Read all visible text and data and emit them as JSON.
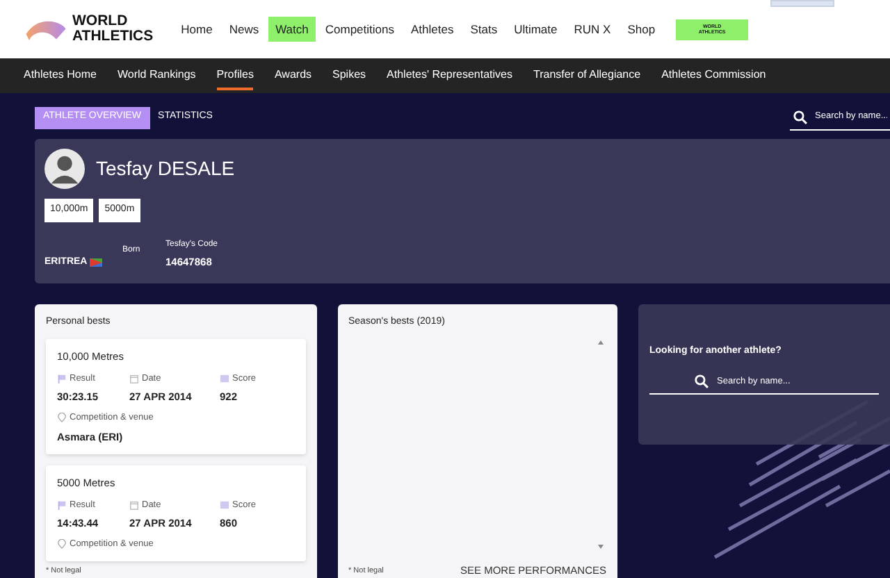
{
  "header": {
    "logo": {
      "line_1": "WORLD",
      "line_2": "ATHLETICS"
    },
    "nav": [
      {
        "label": "Home",
        "selected": false
      },
      {
        "label": "News",
        "selected": false
      },
      {
        "label": "Watch",
        "selected": true
      },
      {
        "label": "Competitions",
        "selected": false
      },
      {
        "label": "Athletes",
        "selected": false
      },
      {
        "label": "Stats",
        "selected": false
      },
      {
        "label": "Ultimate",
        "selected": false
      },
      {
        "label": "RUN X",
        "selected": false
      },
      {
        "label": "Shop",
        "selected": false
      }
    ],
    "promo": {
      "line_1": "WORLD",
      "line_2": "ATHLETICS"
    }
  },
  "subnav": [
    {
      "label": "Athletes Home",
      "selected": false
    },
    {
      "label": "World Rankings",
      "selected": false
    },
    {
      "label": "Profiles",
      "selected": true
    },
    {
      "label": "Awards",
      "selected": false
    },
    {
      "label": "Spikes",
      "selected": false
    },
    {
      "label": "Athletes' Representatives",
      "selected": false
    },
    {
      "label": "Transfer of Allegiance",
      "selected": false
    },
    {
      "label": "Athletes Commission",
      "selected": false
    }
  ],
  "tabs": [
    {
      "label": "ATHLETE OVERVIEW",
      "selected": true
    },
    {
      "label": "STATISTICS",
      "selected": false
    }
  ],
  "top_search": {
    "placeholder": "Search by name..."
  },
  "athlete": {
    "name": "Tesfay DESALE",
    "disciplines": [
      "10,000m",
      "5000m"
    ],
    "country": "ERITREA",
    "born_label": "Born",
    "code_label": "Tesfay's Code",
    "code": "14647868"
  },
  "personal_bests": {
    "title": "Personal bests",
    "items": [
      {
        "event": "10,000 Metres",
        "result_label": "Result",
        "result": "30:23.15",
        "date_label": "Date",
        "date": "27 APR 2014",
        "score_label": "Score",
        "score": "922",
        "venue_label": "Competition & venue",
        "venue": "Asmara (ERI)"
      },
      {
        "event": "5000 Metres",
        "result_label": "Result",
        "result": "14:43.44",
        "date_label": "Date",
        "date": "27 APR 2014",
        "score_label": "Score",
        "score": "860",
        "venue_label": "Competition & venue"
      }
    ],
    "note": "* Not legal"
  },
  "season_bests": {
    "title": "Season's bests (2019)",
    "note": "* Not legal",
    "link": "SEE MORE PERFORMANCES"
  },
  "search_card": {
    "title": "Looking for another athlete?",
    "placeholder": "Search by name..."
  }
}
